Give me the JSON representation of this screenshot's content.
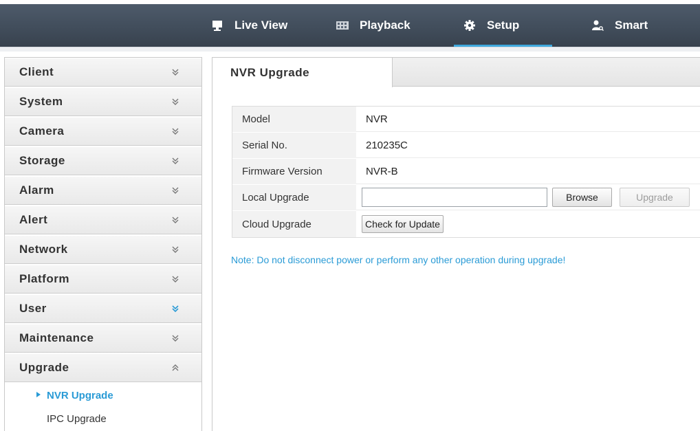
{
  "nav": {
    "items": [
      {
        "label": "Live View",
        "icon": "monitor-icon"
      },
      {
        "label": "Playback",
        "icon": "film-icon"
      },
      {
        "label": "Setup",
        "icon": "gear-icon",
        "active": true
      },
      {
        "label": "Smart",
        "icon": "person-search-icon"
      }
    ],
    "accent_color": "#3fa9de"
  },
  "sidebar": {
    "items": [
      {
        "label": "Client",
        "expanded": false
      },
      {
        "label": "System",
        "expanded": false
      },
      {
        "label": "Camera",
        "expanded": false
      },
      {
        "label": "Storage",
        "expanded": false
      },
      {
        "label": "Alarm",
        "expanded": false
      },
      {
        "label": "Alert",
        "expanded": false
      },
      {
        "label": "Network",
        "expanded": false
      },
      {
        "label": "Platform",
        "expanded": false
      },
      {
        "label": "User",
        "expanded": false
      },
      {
        "label": "Maintenance",
        "expanded": false
      },
      {
        "label": "Upgrade",
        "expanded": true
      }
    ],
    "subitems": [
      {
        "label": "NVR Upgrade",
        "selected": true
      },
      {
        "label": "IPC Upgrade",
        "selected": false
      }
    ]
  },
  "content": {
    "tab_title": "NVR Upgrade",
    "rows": [
      {
        "label": "Model",
        "value": "NVR"
      },
      {
        "label": "Serial No.",
        "value": "210235C"
      },
      {
        "label": "Firmware Version",
        "value": "NVR-B"
      },
      {
        "label": "Local Upgrade"
      },
      {
        "label": "Cloud Upgrade"
      }
    ],
    "local_upgrade_value": "",
    "browse_label": "Browse",
    "upgrade_label": "Upgrade",
    "check_update_label": "Check for Update",
    "note": "Note: Do not disconnect power or perform any other operation during upgrade!"
  }
}
